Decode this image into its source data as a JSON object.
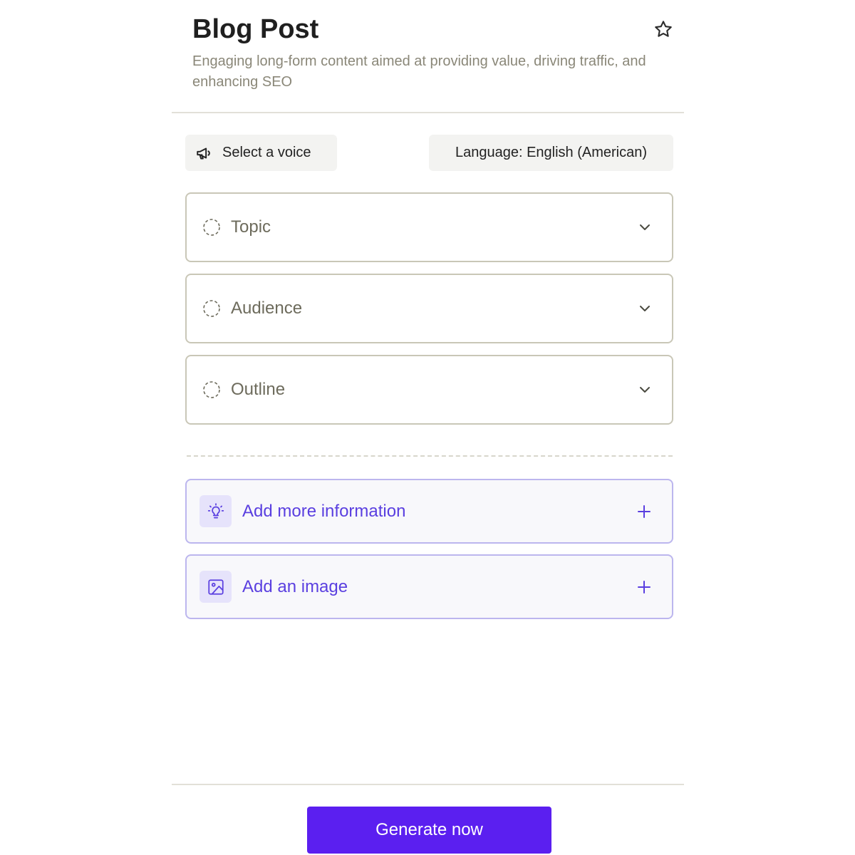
{
  "header": {
    "title": "Blog Post",
    "description": "Engaging long-form content aimed at providing value, driving traffic, and enhancing SEO",
    "favorite_icon": "star-outline-icon"
  },
  "toolbar": {
    "voice_label": "Select a voice",
    "voice_icon": "megaphone-icon",
    "language_label": "Language: English (American)"
  },
  "fields": [
    {
      "label": "Topic",
      "status_icon": "dashed-circle-icon",
      "toggle_icon": "chevron-down-icon"
    },
    {
      "label": "Audience",
      "status_icon": "dashed-circle-icon",
      "toggle_icon": "chevron-down-icon"
    },
    {
      "label": "Outline",
      "status_icon": "dashed-circle-icon",
      "toggle_icon": "chevron-down-icon"
    }
  ],
  "extras": [
    {
      "label": "Add more information",
      "icon": "lightbulb-icon",
      "action_icon": "plus-icon"
    },
    {
      "label": "Add an image",
      "icon": "image-icon",
      "action_icon": "plus-icon"
    }
  ],
  "footer": {
    "generate_label": "Generate now"
  },
  "colors": {
    "accent": "#5b1ff0",
    "accent_text": "#5a3fe0",
    "muted_text": "#8a8778",
    "field_border": "#c9c7b7"
  }
}
